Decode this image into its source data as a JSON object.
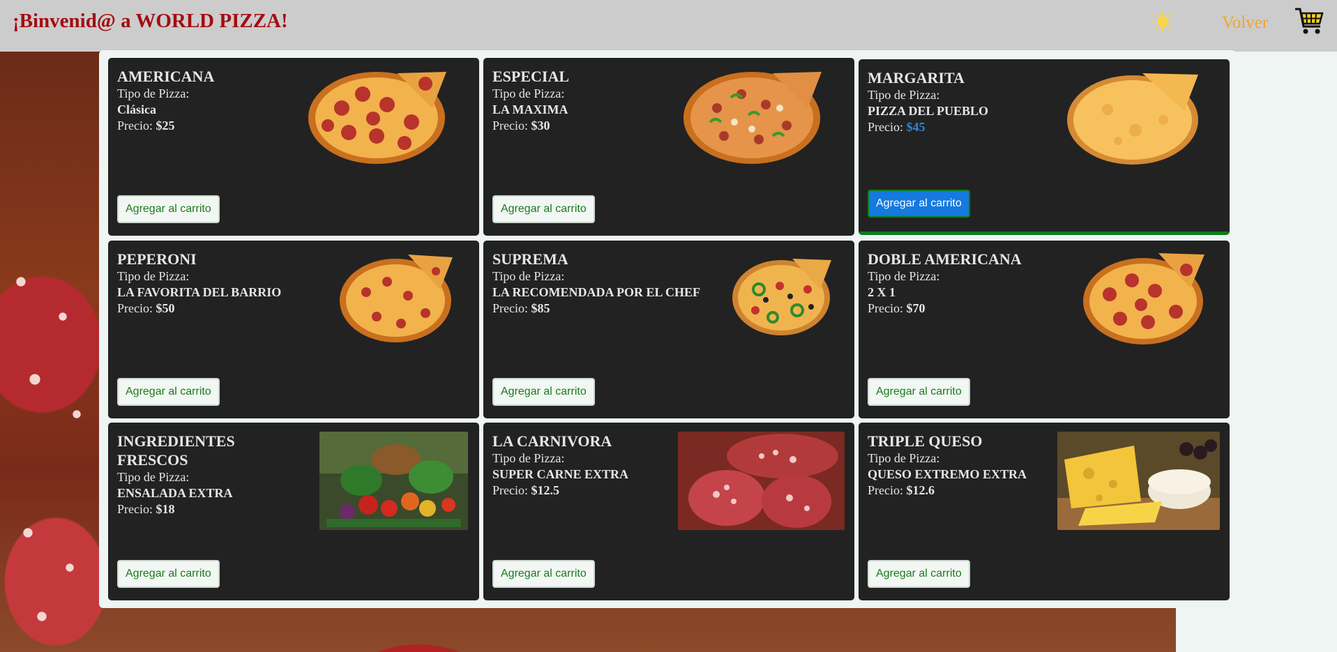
{
  "header": {
    "title": "¡Binvenid@ a WORLD PIZZA!",
    "back_label": "Volver",
    "theme_icon": "sun-icon",
    "cart_icon": "shopping-cart-icon"
  },
  "colors": {
    "title": "#a30d12",
    "back_link": "#f0a62b",
    "card_bg": "#222222",
    "button_text": "#1c7a1f",
    "active_button": "#1479e0",
    "active_price": "#2f86d9"
  },
  "labels": {
    "type_label": "Tipo de Pizza:",
    "price_label": "Precio: ",
    "add_button": "Agregar al carrito"
  },
  "products": [
    {
      "name": "AMERICANA",
      "type": "Clásica",
      "price": "$25",
      "image": "pepperoni-pizza"
    },
    {
      "name": "ESPECIAL",
      "type": "LA MAXIMA",
      "price": "$30",
      "image": "supreme-pizza"
    },
    {
      "name": "MARGARITA",
      "type": "PIZZA DEL PUEBLO",
      "price": "$45",
      "image": "cheese-pizza"
    },
    {
      "name": "PEPERONI",
      "type": "LA FAVORITA DEL BARRIO",
      "price": "$50",
      "image": "pepperoni-pizza"
    },
    {
      "name": "SUPREMA",
      "type": "LA RECOMENDADA POR EL CHEF",
      "price": "$85",
      "image": "veggie-pizza"
    },
    {
      "name": "DOBLE AMERICANA",
      "type": "2 X 1",
      "price": "$70",
      "image": "pepperoni-pizza"
    },
    {
      "name": "INGREDIENTES FRESCOS",
      "type": "ENSALADA EXTRA",
      "price": "$18",
      "image": "vegetables-photo"
    },
    {
      "name": "LA CARNIVORA",
      "type": "SUPER CARNE EXTRA",
      "price": "$12.5",
      "image": "salami-photo"
    },
    {
      "name": "TRIPLE QUESO",
      "type": "QUESO EXTREMO EXTRA",
      "price": "$12.6",
      "image": "cheese-photo"
    }
  ]
}
